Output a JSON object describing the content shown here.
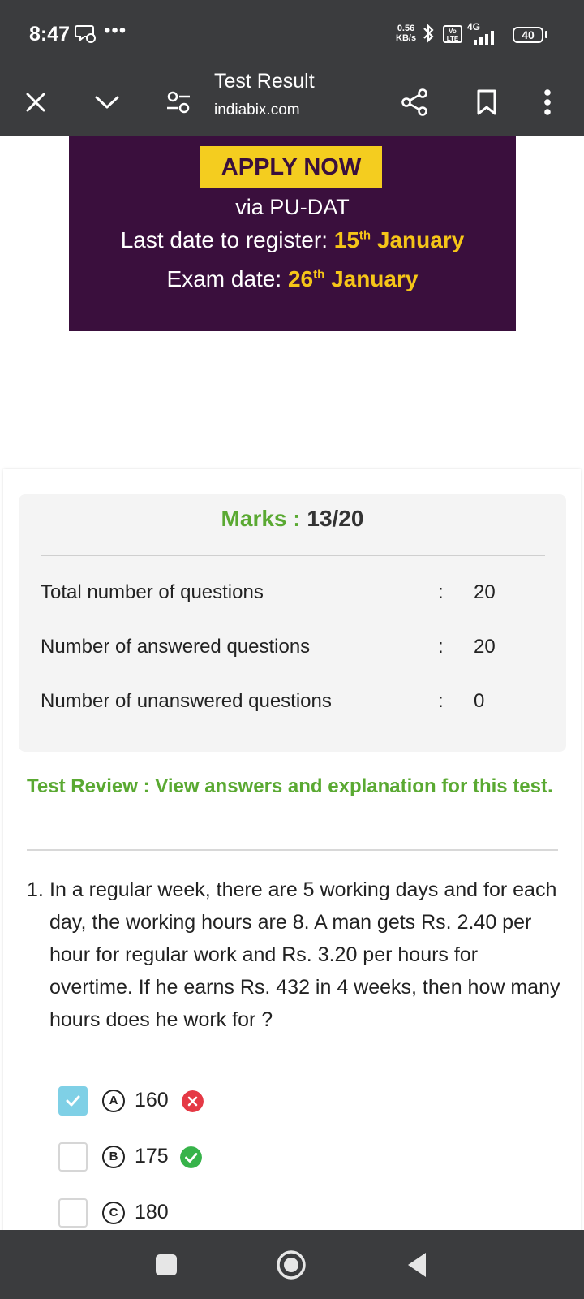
{
  "status_bar": {
    "time": "8:47",
    "dots": "•••",
    "speed_value": "0.56",
    "speed_unit": "KB/s",
    "network": "4G",
    "volte": "Vo LTE",
    "battery": "40"
  },
  "browser": {
    "title": "Test Result",
    "domain": "indiabix.com"
  },
  "banner": {
    "apply_label": "APPLY NOW",
    "via": "via PU-DAT",
    "register_label": "Last date to register:",
    "register_day": "15",
    "register_sup": "th",
    "register_month": "January",
    "exam_label": "Exam date:",
    "exam_day": "26",
    "exam_sup": "th",
    "exam_month": "January"
  },
  "summary": {
    "marks_label": "Marks :",
    "marks_value": "13/20",
    "rows": [
      {
        "label": "Total number of questions",
        "colon": ":",
        "value": "20"
      },
      {
        "label": "Number of answered questions",
        "colon": ":",
        "value": "20"
      },
      {
        "label": "Number of unanswered questions",
        "colon": ":",
        "value": "0"
      }
    ]
  },
  "review": {
    "text": "Test Review : View answers and explanation for this test."
  },
  "question": {
    "number": "1.",
    "text": "In a regular week, there are 5 working days and for each day, the working hours are 8. A man gets Rs. 2.40 per hour for regular work and Rs. 3.20 per hours for overtime. If he earns Rs. 432 in 4 weeks, then how many hours does he work for ?",
    "options": [
      {
        "letter": "A",
        "value": "160",
        "selected": true,
        "result": "wrong"
      },
      {
        "letter": "B",
        "value": "175",
        "selected": false,
        "result": "correct"
      },
      {
        "letter": "C",
        "value": "180",
        "selected": false,
        "result": "none"
      }
    ]
  },
  "colors": {
    "accent_green": "#5aa932",
    "wrong_red": "#e53945",
    "correct_green": "#37b34a",
    "selected_blue": "#7fd0e6",
    "banner_purple": "#3a0f3d",
    "banner_yellow": "#f4cd1f"
  },
  "icons": {
    "status_left": "chat-icon",
    "bluetooth": "bluetooth-icon",
    "signal": "signal-icon",
    "close": "close-icon",
    "expand": "chevron-down-icon",
    "settings": "tune-icon",
    "share": "share-icon",
    "bookmark": "bookmark-icon",
    "menu": "more-vertical-icon",
    "nav_recents": "recents-icon",
    "nav_home": "home-icon",
    "nav_back": "back-icon"
  }
}
